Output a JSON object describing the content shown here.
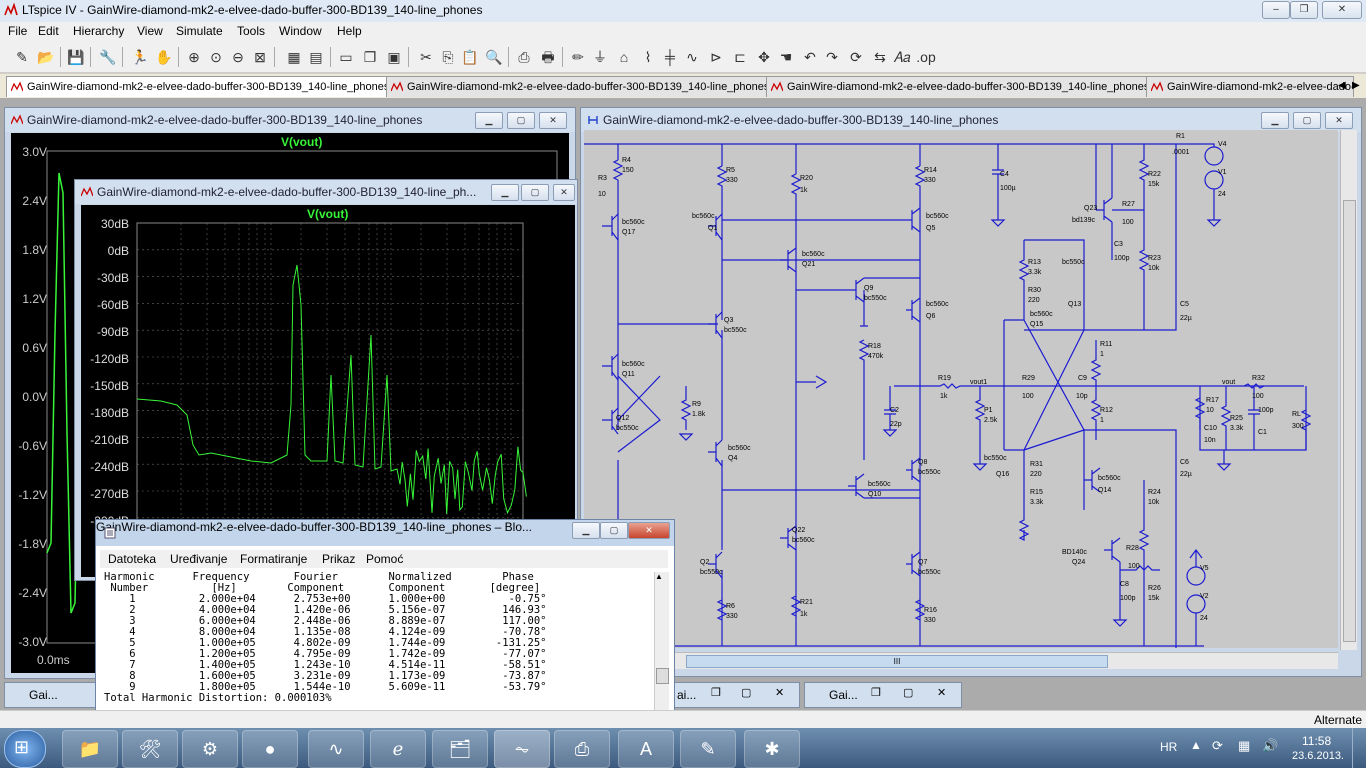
{
  "app": {
    "title": "LTspice IV - GainWire-diamond-mk2-e-elvee-dado-buffer-300-BD139_140-line_phones",
    "win_min": "‒",
    "win_max": "❐",
    "win_close": "✕"
  },
  "menubar": [
    "File",
    "Edit",
    "Hierarchy",
    "View",
    "Simulate",
    "Tools",
    "Window",
    "Help"
  ],
  "tabs": [
    "GainWire-diamond-mk2-e-elvee-dado-buffer-300-BD139_140-line_phones",
    "GainWire-diamond-mk2-e-elvee-dado-buffer-300-BD139_140-line_phones",
    "GainWire-diamond-mk2-e-elvee-dado-buffer-300-BD139_140-line_phones",
    "GainWire-diamond-mk2-e-elvee-dado-buffer-300-BD139_140-line_phones"
  ],
  "transient_window": {
    "title": "GainWire-diamond-mk2-e-elvee-dado-buffer-300-BD139_140-line_phones",
    "trace": "V(vout)",
    "y_ticks": [
      "3.0V",
      "2.4V",
      "1.8V",
      "1.2V",
      "0.6V",
      "0.0V",
      "-0.6V",
      "-1.2V",
      "-1.8V",
      "-2.4V",
      "-3.0V"
    ],
    "x_start": "0.0ms"
  },
  "fft_window": {
    "title": "GainWire-diamond-mk2-e-elvee-dado-buffer-300-BD139_140-line_ph...",
    "trace": "V(vout)",
    "y_ticks": [
      "30dB",
      "0dB",
      "-30dB",
      "-60dB",
      "-90dB",
      "-120dB",
      "-150dB",
      "-180dB",
      "-210dB",
      "-240dB",
      "-270dB",
      "-300dB"
    ]
  },
  "schematic_window": {
    "title": "GainWire-diamond-mk2-e-elvee-dado-buffer-300-BD139_140-line_phones",
    "labels": {
      "r1": "R1",
      "r1v": ".0001",
      "v4": "V4",
      "v1": "V1",
      "v1v": "24",
      "r4": "R4",
      "r4v": "150",
      "r3": "R3",
      "r3v": "10",
      "r5": "R5",
      "r5v": "330",
      "r20": "R20",
      "r20v": "1k",
      "r14": "R14",
      "r14v": "330",
      "c4": "C4",
      "c4v": "100µ",
      "r22": "R22",
      "r22v": "15k",
      "q23": "Q23",
      "q23t": "bd139c",
      "r27": "R27",
      "r27v": "100",
      "q17t": "bc560c",
      "q17": "Q17",
      "q1t": "bc560c",
      "q1": "Q1",
      "q21t": "bc560c",
      "q21": "Q21",
      "q5t": "bc560c",
      "q5": "Q5",
      "c3": "C3",
      "c3v": "100p",
      "r23": "R23",
      "r23v": "10k",
      "r13": "R13",
      "r13v": "3.3k",
      "q13t": "bc550c",
      "q13": "Q13",
      "q9": "Q9",
      "q9t": "bc550c",
      "q6t": "bc560c",
      "q6": "Q6",
      "r30": "R30",
      "r30v": "220",
      "q15t": "bc560c",
      "q15": "Q15",
      "c5": "C5",
      "c5v": "22µ",
      "q3": "Q3",
      "q3t": "bc550c",
      "r18": "R18",
      "r18v": "470k",
      "r11": "R11",
      "r11v": "1",
      "q11t": "bc560c",
      "q11": "Q11",
      "r19": "R19",
      "r19v": "1k",
      "vout1": "vout1",
      "r29": "R29",
      "r29v": "100",
      "c9": "C9",
      "c9v": "10p",
      "vout": "vout",
      "r32": "R32",
      "r32v": "100",
      "r9": "R9",
      "r9v": "1.8k",
      "c2": "C2",
      "c2v": "22p",
      "p1": "P1",
      "p1v": "2.5k",
      "r17": "R17",
      "r17v": "10",
      "r25": "R25",
      "r25v": "3.3k",
      "c1": "C1",
      "c1v": "100p",
      "rl": "RL",
      "rlv": "300",
      "c10": "C10",
      "c10v": "10n",
      "r12": "R12",
      "r12v": "1",
      "q12": "Q12",
      "q12t": "bc550c",
      "q4t": "bc560c",
      "q4": "Q4",
      "q16t": "bc550c",
      "q16": "Q16",
      "r31": "R31",
      "r31v": "220",
      "c6": "C6",
      "c6v": "22µ",
      "q8": "Q8",
      "q8t": "bc550c",
      "q10t": "bc560c",
      "q10": "Q10",
      "r15": "R15",
      "r15v": "3.3k",
      "q14t": "bc560c",
      "q14": "Q14",
      "r24": "R24",
      "r24v": "10k",
      "q22": "Q22",
      "q22t": "bc560c",
      "bd140t": "BD140c",
      "q24": "Q24",
      "r28": "R28",
      "r28v": "100",
      "q2": "Q2",
      "q2t": "bc550c",
      "q7": "Q7",
      "q7t": "bc550c",
      "c8": "C8",
      "c8v": "100p",
      "r26": "R26",
      "r26v": "15k",
      "v5": "V5",
      "v2": "V2",
      "v2v": "24",
      "r6": "R6",
      "r6v": "330",
      "r21": "R21",
      "r21v": "1k",
      "r16": "R16",
      "r16v": "330"
    },
    "scroll_grip": "III"
  },
  "log_window": {
    "title": "GainWire-diamond-mk2-e-elvee-dado-buffer-300-BD139_140-line_phones – Blo...",
    "menu": [
      "Datoteka",
      "Uređivanje",
      "Formatiranje",
      "Prikaz",
      "Pomoć"
    ],
    "header1": "Harmonic      Frequency       Fourier        Normalized        Phase",
    "header2": " Number          [Hz]        Component       Component       [degree]",
    "rows": [
      "    1          2.000e+04      2.753e+00      1.000e+00          -0.75°",
      "    2          4.000e+04      1.420e-06      5.156e-07         146.93°",
      "    3          6.000e+04      2.448e-06      8.889e-07         117.00°",
      "    4          8.000e+04      1.135e-08      4.124e-09         -70.78°",
      "    5          1.000e+05      4.802e-09      1.744e-09        -131.25°",
      "    6          1.200e+05      4.795e-09      1.742e-09         -77.07°",
      "    7          1.400e+05      1.243e-10      4.514e-11         -58.51°",
      "    8          1.600e+05      3.231e-09      1.173e-09         -73.87°",
      "    9          1.800e+05      1.544e-10      5.609e-11         -53.79°"
    ],
    "thd": "Total Harmonic Distortion: 0.000103%"
  },
  "minimized": [
    "Gai...",
    "ai...",
    "Gai..."
  ],
  "status": "Alternate",
  "taskbar": {
    "lang": "HR",
    "time": "11:58",
    "date": "23.6.2013."
  }
}
